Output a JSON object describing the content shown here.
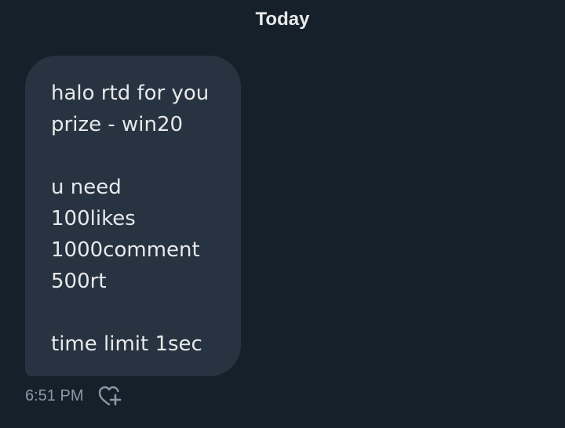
{
  "header": {
    "date_label": "Today"
  },
  "message": {
    "lines": [
      "halo rtd for you",
      "prize - win20",
      "",
      "u need",
      "100likes",
      "1000comment",
      "500rt",
      "",
      "time limit 1sec"
    ],
    "timestamp": "6:51 PM",
    "reaction_icon": "heart-plus-icon"
  },
  "colors": {
    "background": "#15202b",
    "bubble": "#273340",
    "text": "#e7e9ea",
    "muted": "#8b98a5"
  }
}
